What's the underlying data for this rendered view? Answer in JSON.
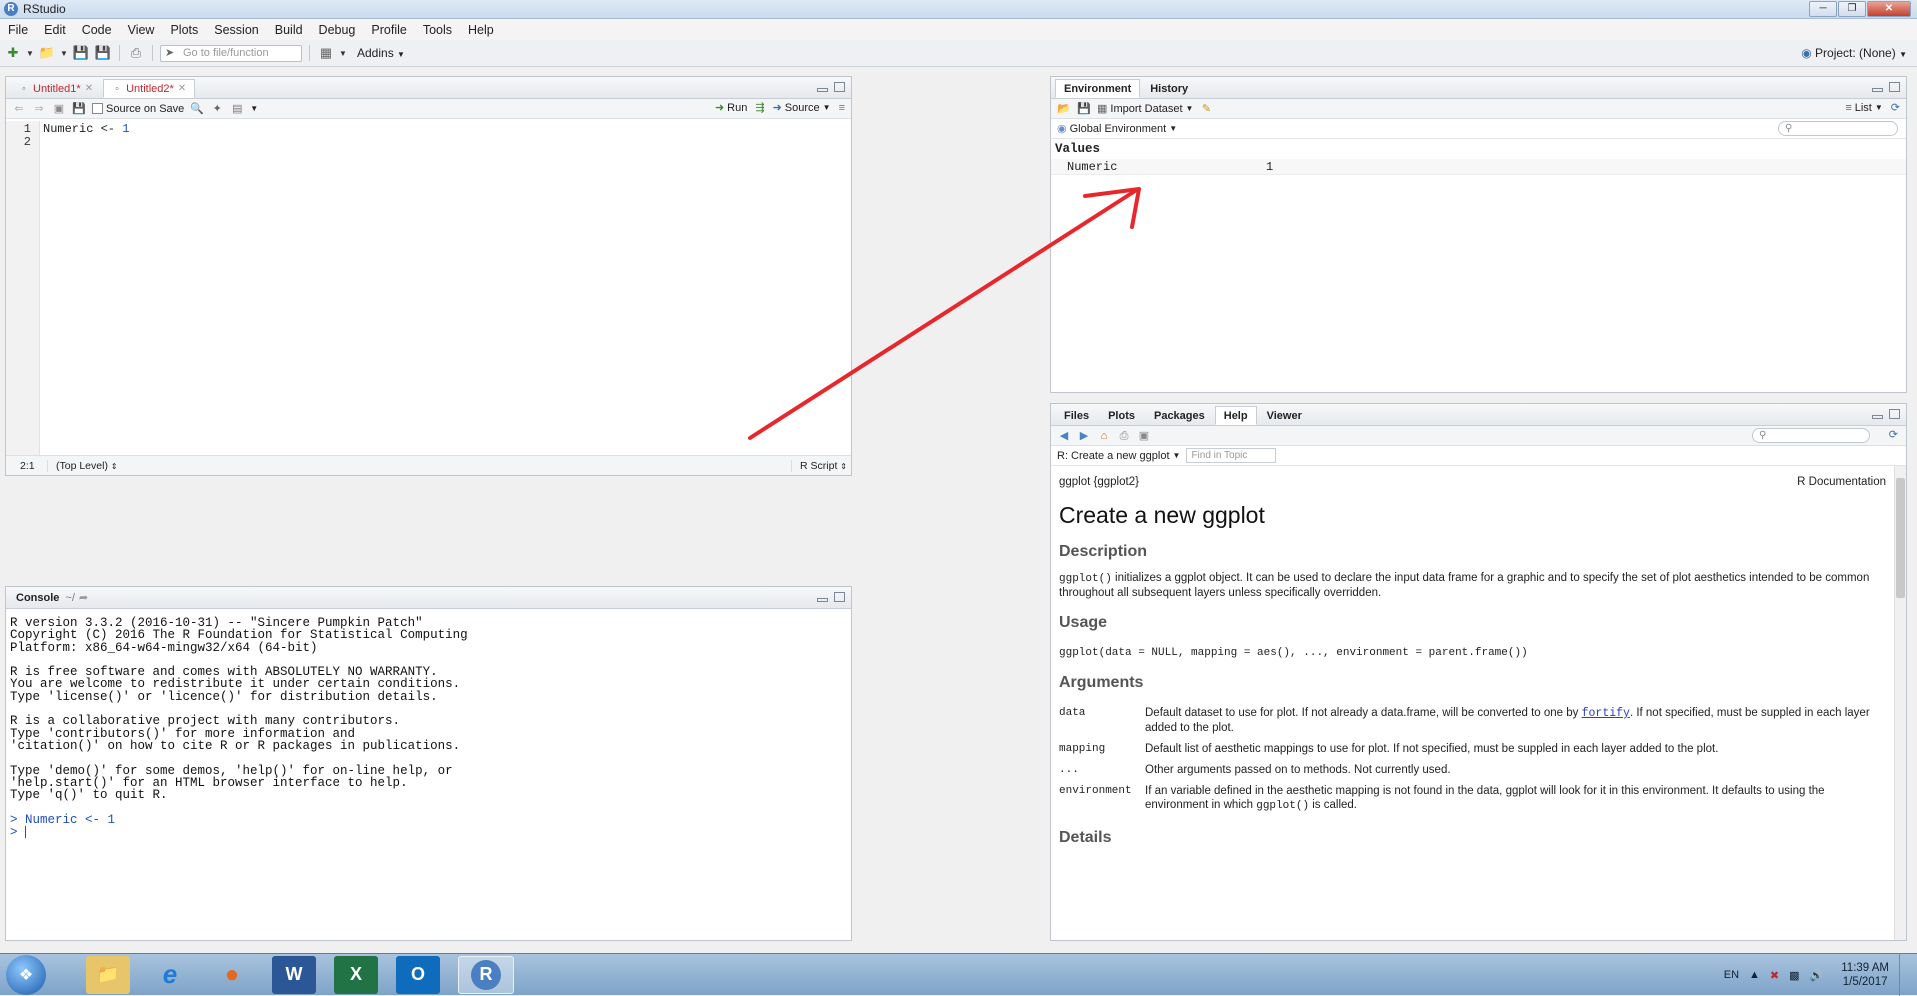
{
  "window": {
    "title": "RStudio"
  },
  "menu": [
    "File",
    "Edit",
    "Code",
    "View",
    "Plots",
    "Session",
    "Build",
    "Debug",
    "Profile",
    "Tools",
    "Help"
  ],
  "toolbar": {
    "goto_placeholder": "Go to file/function",
    "addins": "Addins",
    "project": "Project: (None)"
  },
  "editor": {
    "tabs": [
      {
        "label": "Untitled1*",
        "active": false
      },
      {
        "label": "Untitled2*",
        "active": true
      }
    ],
    "source_on_save": "Source on Save",
    "run": "Run",
    "source": "Source",
    "line_numbers": [
      "1",
      "2"
    ],
    "code_line1_ident": "Numeric <- ",
    "code_line1_value": "1",
    "status_position": "2:1",
    "status_scope": "(Top Level)",
    "status_filetype": "R Script"
  },
  "console": {
    "title": "Console",
    "path": "~/",
    "lines": [
      "R version 3.3.2 (2016-10-31) -- \"Sincere Pumpkin Patch\"",
      "Copyright (C) 2016 The R Foundation for Statistical Computing",
      "Platform: x86_64-w64-mingw32/x64 (64-bit)",
      "",
      "R is free software and comes with ABSOLUTELY NO WARRANTY.",
      "You are welcome to redistribute it under certain conditions.",
      "Type 'license()' or 'licence()' for distribution details.",
      "",
      "R is a collaborative project with many contributors.",
      "Type 'contributors()' for more information and",
      "'citation()' on how to cite R or R packages in publications.",
      "",
      "Type 'demo()' for some demos, 'help()' for on-line help, or",
      "'help.start()' for an HTML browser interface to help.",
      "Type 'q()' to quit R.",
      ""
    ],
    "command": "> Numeric <- 1",
    "prompt": "> "
  },
  "environment": {
    "tabs": [
      "Environment",
      "History"
    ],
    "import_dataset": "Import Dataset",
    "view_mode": "List",
    "scope": "Global Environment",
    "section": "Values",
    "rows": [
      {
        "name": "Numeric",
        "value": "1"
      }
    ]
  },
  "help": {
    "tabs": [
      "Files",
      "Plots",
      "Packages",
      "Help",
      "Viewer"
    ],
    "topic": "R: Create a new ggplot",
    "find_placeholder": "Find in Topic",
    "header_left": "ggplot {ggplot2}",
    "header_right": "R Documentation",
    "title": "Create a new ggplot",
    "description_heading": "Description",
    "description_code": "ggplot()",
    "description_text": " initializes a ggplot object. It can be used to declare the input data frame for a graphic and to specify the set of plot aesthetics intended to be common throughout all subsequent layers unless specifically overridden.",
    "usage_heading": "Usage",
    "usage_code": "ggplot(data = NULL, mapping = aes(), ..., environment = parent.frame())",
    "arguments_heading": "Arguments",
    "args": [
      {
        "name": "data",
        "desc_pre": "Default dataset to use for plot. If not already a data.frame, will be converted to one by ",
        "link": "fortify",
        "desc_post": ". If not specified, must be suppled in each layer added to the plot."
      },
      {
        "name": "mapping",
        "desc_pre": "Default list of aesthetic mappings to use for plot. If not specified, must be suppled in each layer added to the plot.",
        "link": "",
        "desc_post": ""
      },
      {
        "name": "...",
        "desc_pre": "Other arguments passed on to methods. Not currently used.",
        "link": "",
        "desc_post": ""
      },
      {
        "name": "environment",
        "desc_pre": "If an variable defined in the aesthetic mapping is not found in the data, ggplot will look for it in this environment. It defaults to using the environment in which ",
        "link": "",
        "code": "ggplot()",
        "desc_post": " is called."
      }
    ],
    "details_heading": "Details"
  },
  "taskbar": {
    "language": "EN",
    "time": "11:39 AM",
    "date": "1/5/2017"
  },
  "colors": {
    "annotation_arrow": "#e8272d",
    "accent": "#1f4fbf"
  }
}
